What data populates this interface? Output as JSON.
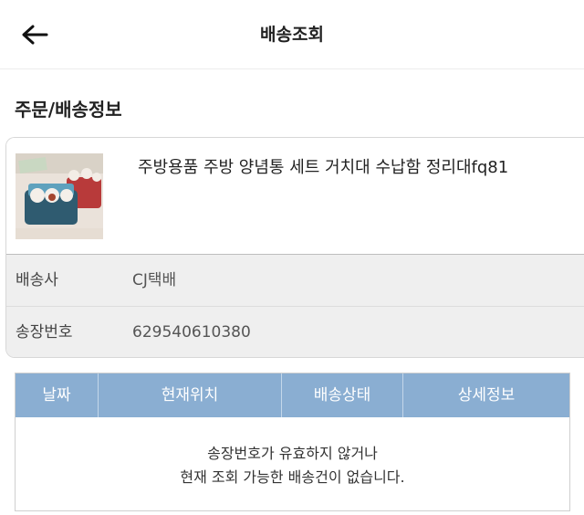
{
  "header": {
    "title": "배송조회",
    "back_icon": "arrow-left-icon"
  },
  "section": {
    "title": "주문/배송정보"
  },
  "product": {
    "name": "주방용품 주방 양념통 세트 거치대 수납함 정리대fq81"
  },
  "shipping": {
    "carrier_label": "배송사",
    "carrier_value": "CJ택배",
    "tracking_label": "송장번호",
    "tracking_value": "629540610380"
  },
  "tracking_table": {
    "columns": [
      "날짜",
      "현재위치",
      "배송상태",
      "상세정보"
    ],
    "empty_message_line1": "송장번호가 유효하지 않거나",
    "empty_message_line2": "현재 조회 가능한 배송건이 없습니다."
  },
  "colors": {
    "table_header_bg": "#8aaed2",
    "info_row_bg": "#efefef"
  }
}
